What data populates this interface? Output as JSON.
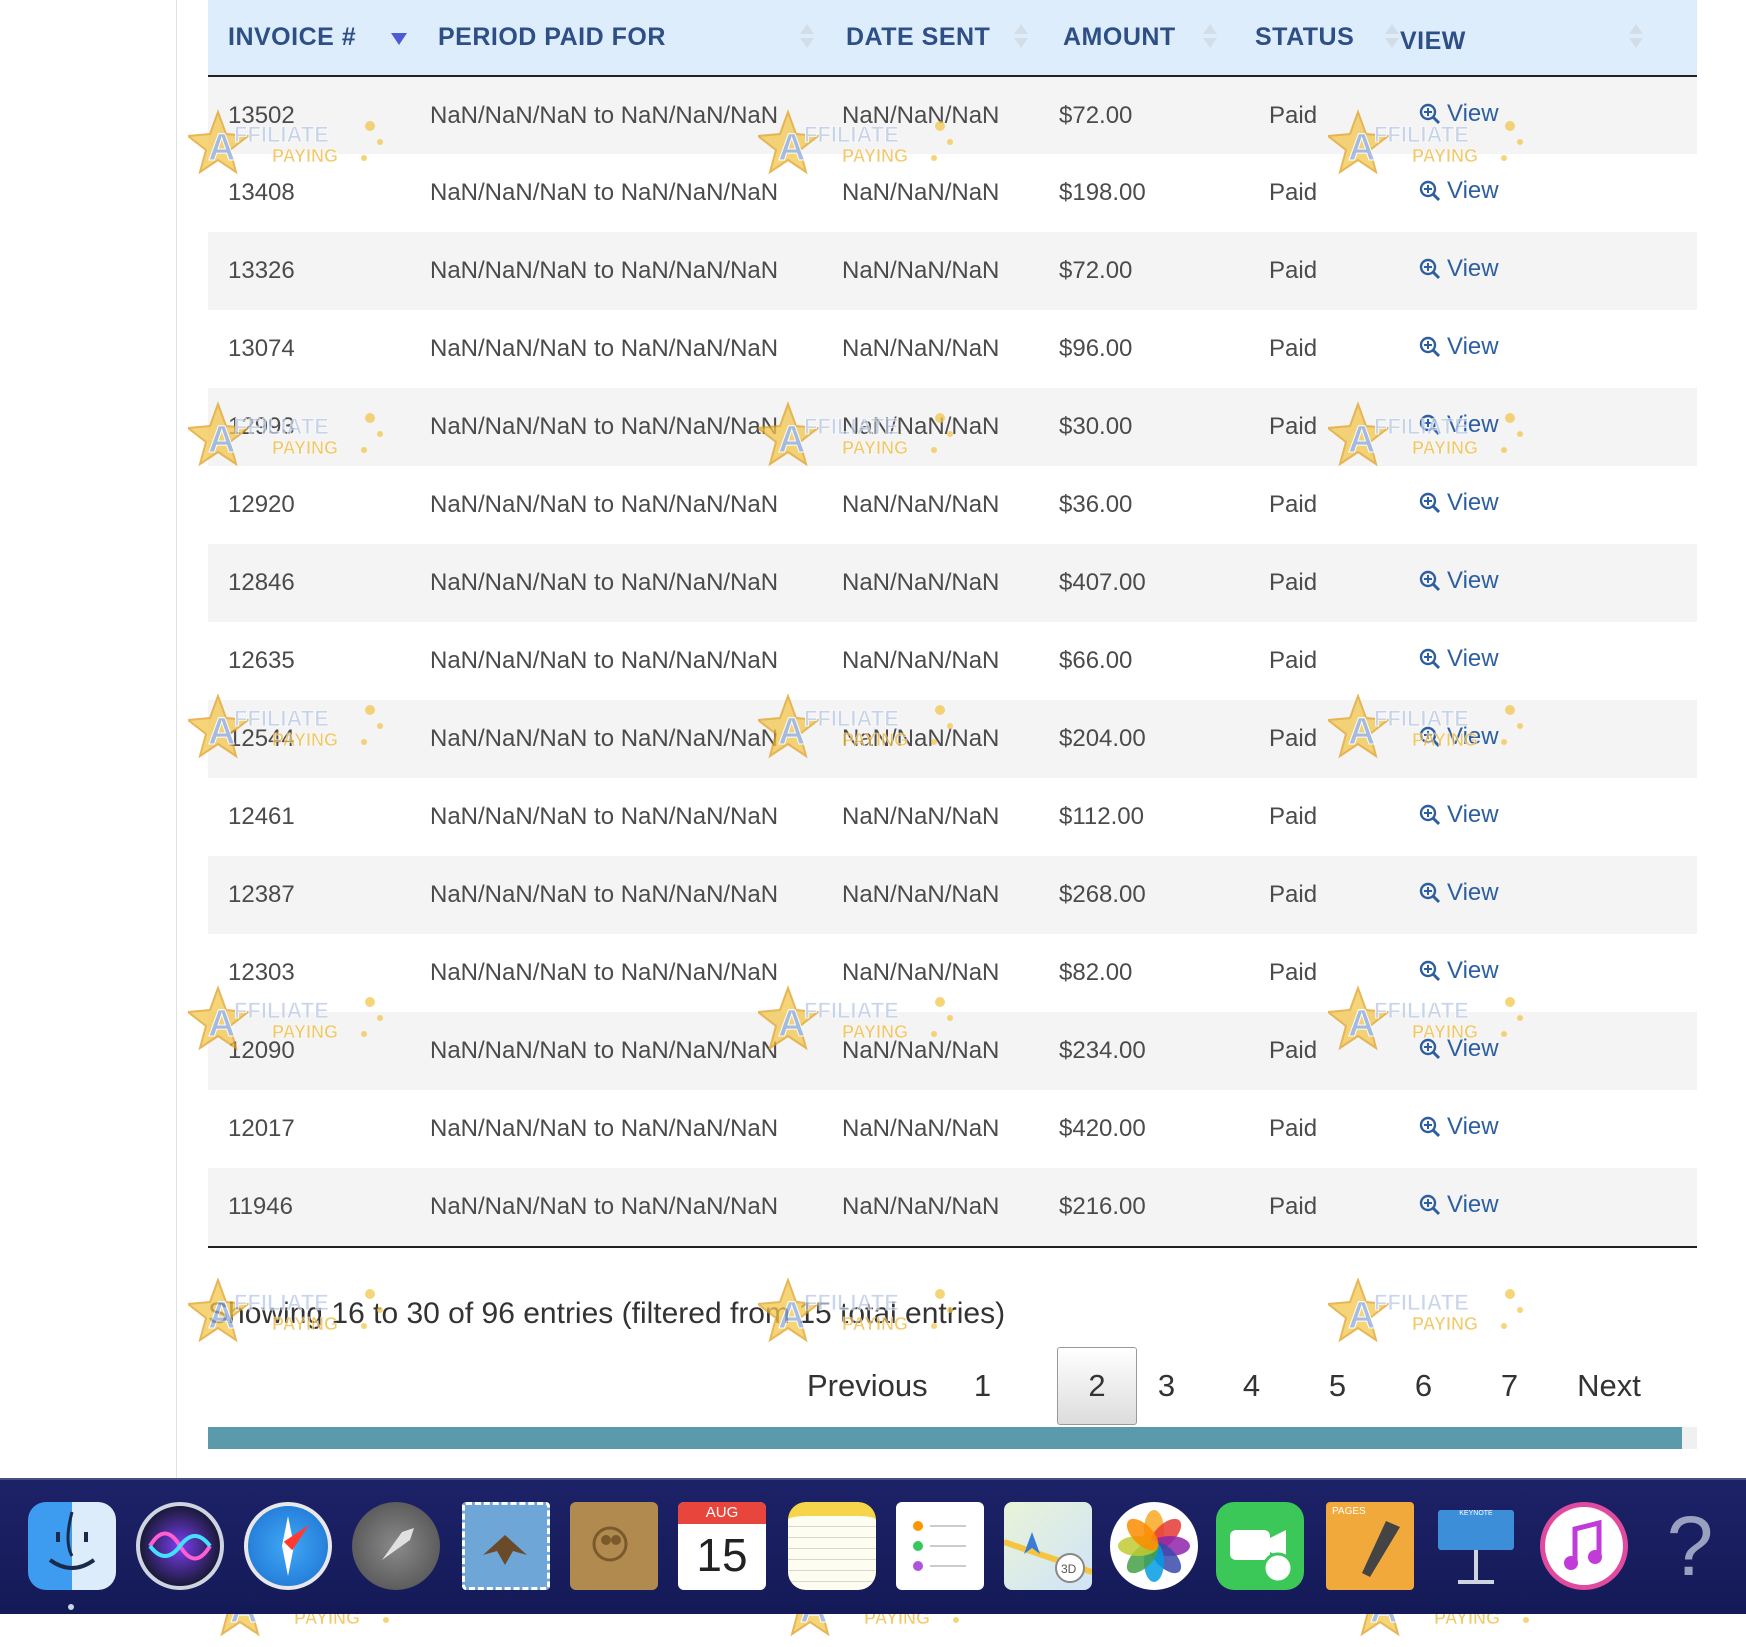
{
  "table": {
    "columns": [
      {
        "label": "INVOICE #",
        "sort": "desc"
      },
      {
        "label": "PERIOD PAID FOR",
        "sort": "none"
      },
      {
        "label": "DATE SENT",
        "sort": "none"
      },
      {
        "label": "AMOUNT",
        "sort": "none"
      },
      {
        "label": "STATUS",
        "sort": "none"
      },
      {
        "label": "VIEW",
        "sort": "none"
      }
    ],
    "rows": [
      {
        "invoice": "13502",
        "period": "NaN/NaN/NaN to NaN/NaN/NaN",
        "date": "NaN/NaN/NaN",
        "amount": "$72.00",
        "status": "Paid",
        "view": "View"
      },
      {
        "invoice": "13408",
        "period": "NaN/NaN/NaN to NaN/NaN/NaN",
        "date": "NaN/NaN/NaN",
        "amount": "$198.00",
        "status": "Paid",
        "view": "View"
      },
      {
        "invoice": "13326",
        "period": "NaN/NaN/NaN to NaN/NaN/NaN",
        "date": "NaN/NaN/NaN",
        "amount": "$72.00",
        "status": "Paid",
        "view": "View"
      },
      {
        "invoice": "13074",
        "period": "NaN/NaN/NaN to NaN/NaN/NaN",
        "date": "NaN/NaN/NaN",
        "amount": "$96.00",
        "status": "Paid",
        "view": "View"
      },
      {
        "invoice": "12993",
        "period": "NaN/NaN/NaN to NaN/NaN/NaN",
        "date": "NaN/NaN/NaN",
        "amount": "$30.00",
        "status": "Paid",
        "view": "View"
      },
      {
        "invoice": "12920",
        "period": "NaN/NaN/NaN to NaN/NaN/NaN",
        "date": "NaN/NaN/NaN",
        "amount": "$36.00",
        "status": "Paid",
        "view": "View"
      },
      {
        "invoice": "12846",
        "period": "NaN/NaN/NaN to NaN/NaN/NaN",
        "date": "NaN/NaN/NaN",
        "amount": "$407.00",
        "status": "Paid",
        "view": "View"
      },
      {
        "invoice": "12635",
        "period": "NaN/NaN/NaN to NaN/NaN/NaN",
        "date": "NaN/NaN/NaN",
        "amount": "$66.00",
        "status": "Paid",
        "view": "View"
      },
      {
        "invoice": "12544",
        "period": "NaN/NaN/NaN to NaN/NaN/NaN",
        "date": "NaN/NaN/NaN",
        "amount": "$204.00",
        "status": "Paid",
        "view": "View"
      },
      {
        "invoice": "12461",
        "period": "NaN/NaN/NaN to NaN/NaN/NaN",
        "date": "NaN/NaN/NaN",
        "amount": "$112.00",
        "status": "Paid",
        "view": "View"
      },
      {
        "invoice": "12387",
        "period": "NaN/NaN/NaN to NaN/NaN/NaN",
        "date": "NaN/NaN/NaN",
        "amount": "$268.00",
        "status": "Paid",
        "view": "View"
      },
      {
        "invoice": "12303",
        "period": "NaN/NaN/NaN to NaN/NaN/NaN",
        "date": "NaN/NaN/NaN",
        "amount": "$82.00",
        "status": "Paid",
        "view": "View"
      },
      {
        "invoice": "12090",
        "period": "NaN/NaN/NaN to NaN/NaN/NaN",
        "date": "NaN/NaN/NaN",
        "amount": "$234.00",
        "status": "Paid",
        "view": "View"
      },
      {
        "invoice": "12017",
        "period": "NaN/NaN/NaN to NaN/NaN/NaN",
        "date": "NaN/NaN/NaN",
        "amount": "$420.00",
        "status": "Paid",
        "view": "View"
      },
      {
        "invoice": "11946",
        "period": "NaN/NaN/NaN to NaN/NaN/NaN",
        "date": "NaN/NaN/NaN",
        "amount": "$216.00",
        "status": "Paid",
        "view": "View"
      }
    ]
  },
  "info_text": "Showing 16 to 30 of 96 entries (filtered from 15 total entries)",
  "pagination": {
    "previous": "Previous",
    "next": "Next",
    "pages": [
      "1",
      "2",
      "3",
      "4",
      "5",
      "6",
      "7"
    ],
    "current": "2"
  },
  "scroll_progress": 0.99,
  "watermark": {
    "line1": "AFFILIATE",
    "line2": "PAYING"
  },
  "dock": {
    "calendar_month": "AUG",
    "calendar_day": "15",
    "pages_label": "PAGES",
    "keynote_label": "KEYNOTE",
    "help_glyph": "?"
  },
  "colors": {
    "header_bg": "#ddedfc",
    "header_text": "#2e4f86",
    "link": "#2d5fa0",
    "progress_fill": "#5a9aab",
    "dock_bg": "#171d5e"
  }
}
